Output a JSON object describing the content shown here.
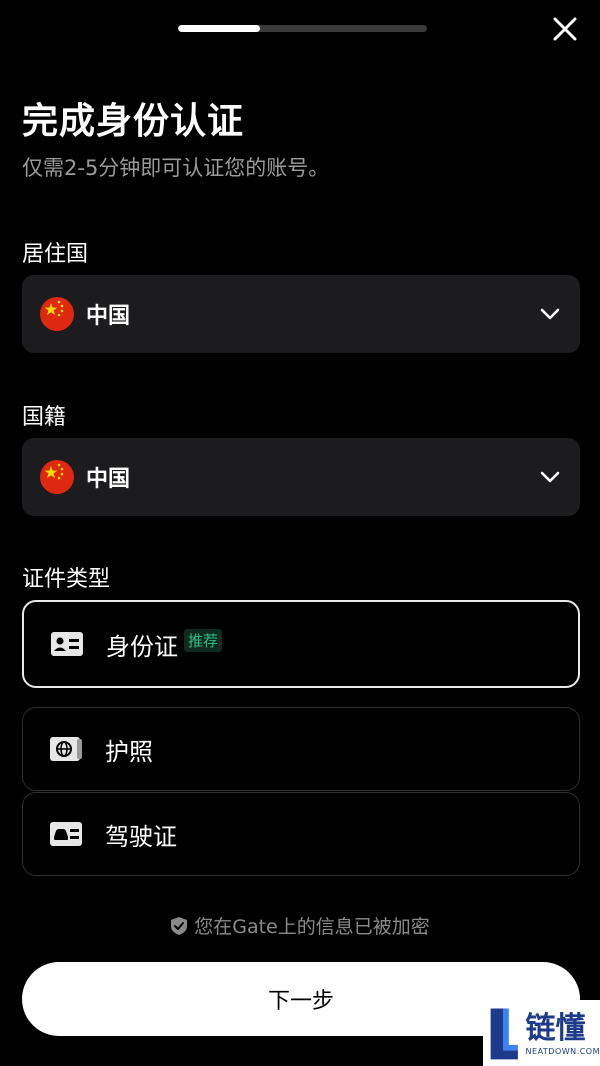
{
  "progress": {
    "fraction": 0.33
  },
  "header": {
    "title": "完成身份认证",
    "subtitle": "仅需2-5分钟即可认证您的账号。"
  },
  "residence": {
    "label": "居住国",
    "value": "中国",
    "flag": "china-flag"
  },
  "nationality": {
    "label": "国籍",
    "value": "中国",
    "flag": "china-flag"
  },
  "document_type": {
    "label": "证件类型",
    "options": [
      {
        "label": "身份证",
        "badge": "推荐",
        "icon": "id-card-icon",
        "selected": true
      },
      {
        "label": "护照",
        "icon": "passport-icon",
        "selected": false
      },
      {
        "label": "驾驶证",
        "icon": "driver-license-icon",
        "selected": false
      }
    ]
  },
  "security_note": "您在Gate上的信息已被加密",
  "next_button": "下一步",
  "watermark": {
    "cn": "链懂",
    "en": "NEATDOWN.COM"
  },
  "colors": {
    "background": "#000000",
    "field": "#1c1c1e",
    "badge": "#2ebd85",
    "flag_red": "#de2910",
    "flag_star": "#ffde00"
  }
}
